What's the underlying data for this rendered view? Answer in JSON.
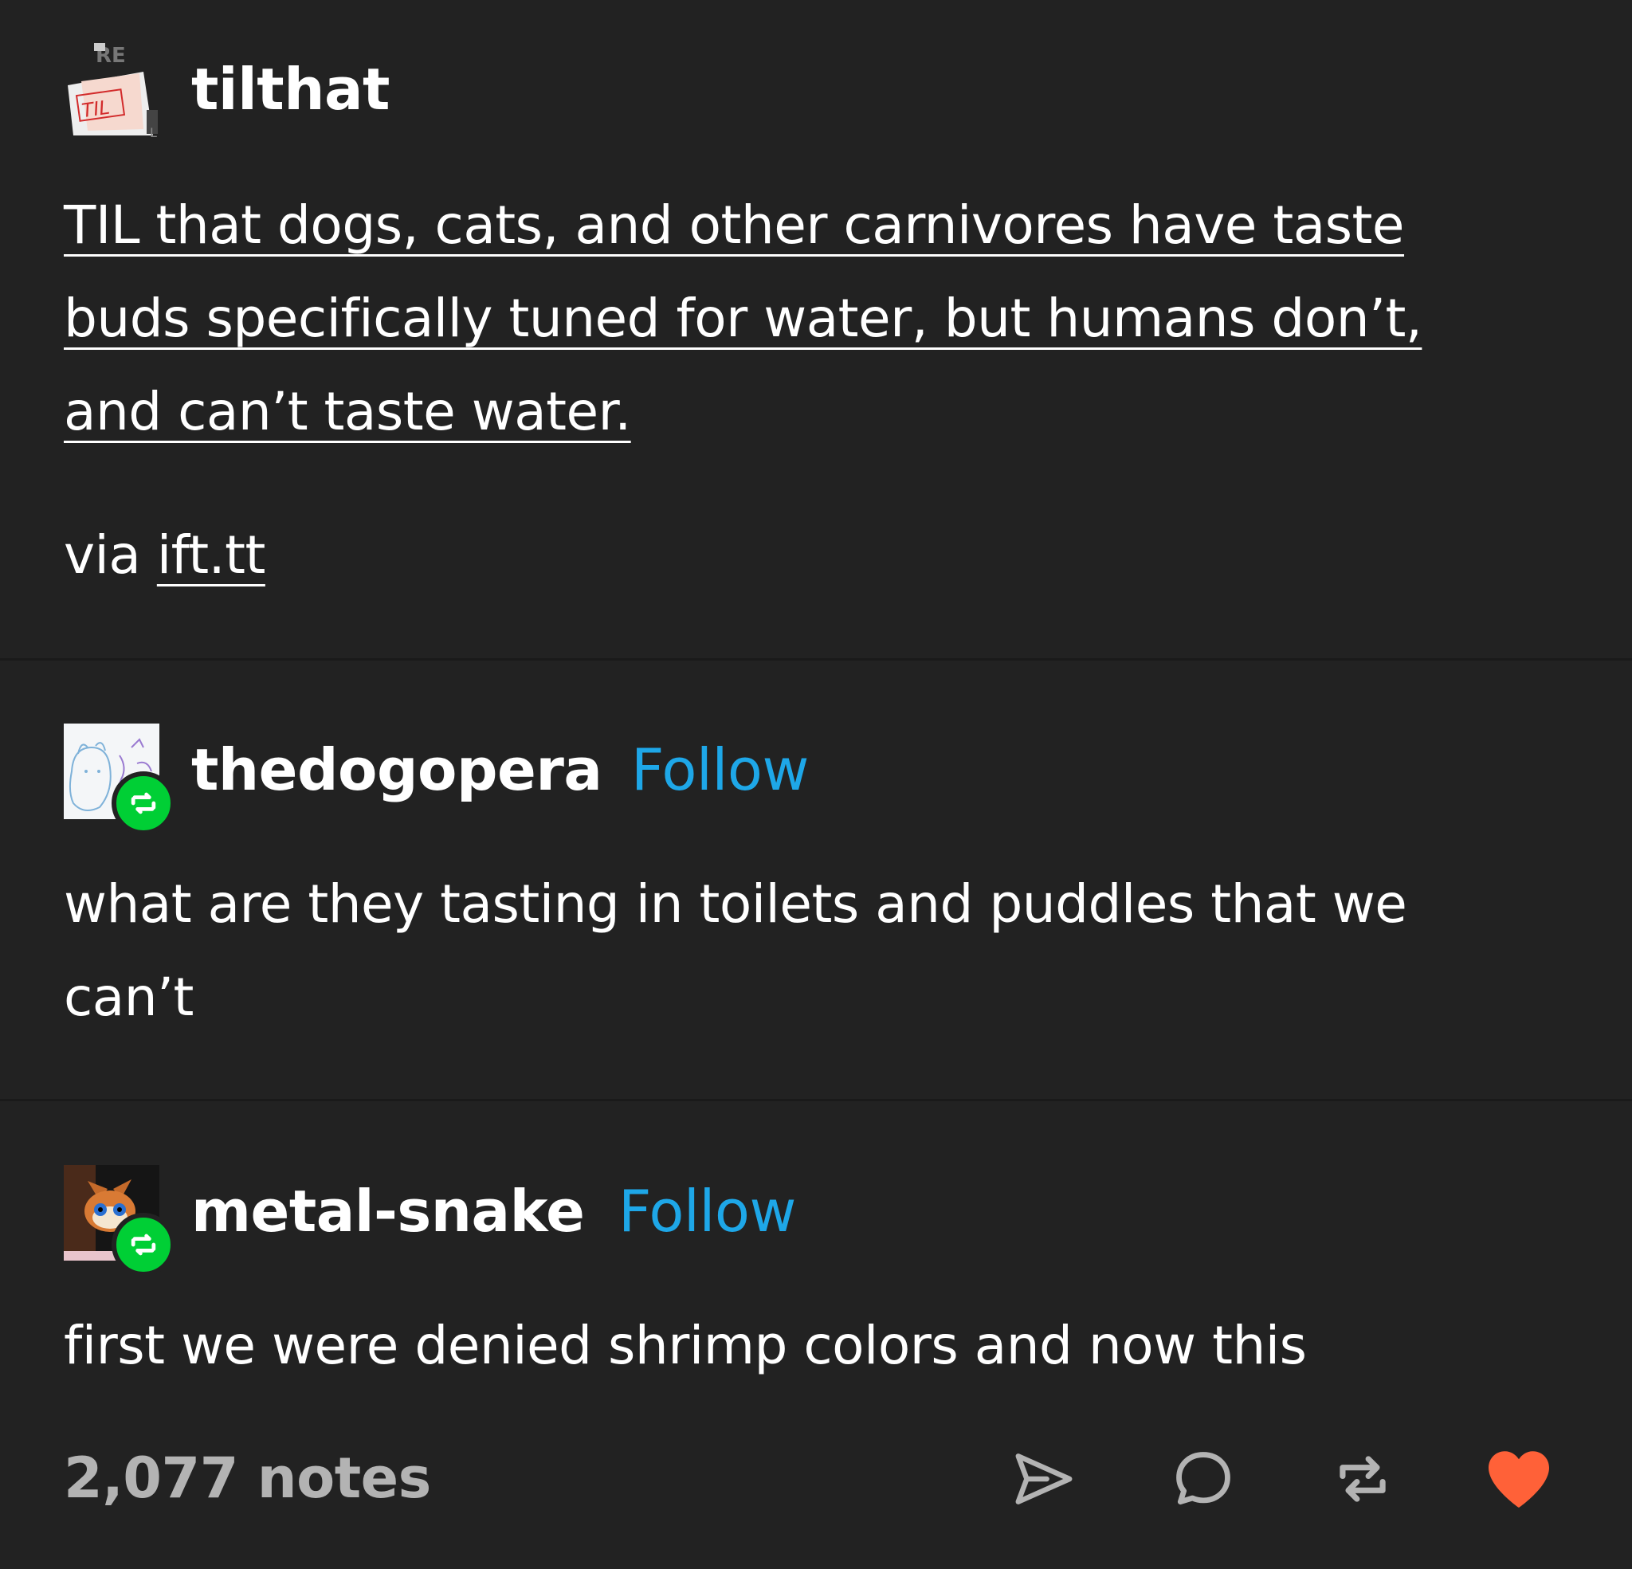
{
  "original_post": {
    "username": "tilthat",
    "avatar_text": "TIL",
    "title_lines": [
      "TIL that dogs, cats, and other carnivores have taste",
      "buds specifically tuned for water, but humans don’t,",
      "and can’t taste water."
    ],
    "via_prefix": "via ",
    "via_link": "ift.tt"
  },
  "reblogs": [
    {
      "username": "thedogopera",
      "follow_label": "Follow",
      "text_lines": [
        "what are they tasting in toilets and puddles that we",
        "can’t"
      ]
    },
    {
      "username": "metal-snake",
      "follow_label": "Follow",
      "text_lines": [
        "first we were denied shrimp colors and now this"
      ]
    }
  ],
  "footer": {
    "notes": "2,077 notes",
    "actions": [
      {
        "icon": "send-icon"
      },
      {
        "icon": "reply-icon"
      },
      {
        "icon": "reblog-icon"
      },
      {
        "icon": "heart-icon",
        "color": "#ff6138"
      }
    ]
  },
  "colors": {
    "background": "#222222",
    "text": "#ffffff",
    "follow": "#1ea7e8",
    "reblog_badge": "#00cf35",
    "muted": "#b3b3b3",
    "like": "#ff6138"
  }
}
